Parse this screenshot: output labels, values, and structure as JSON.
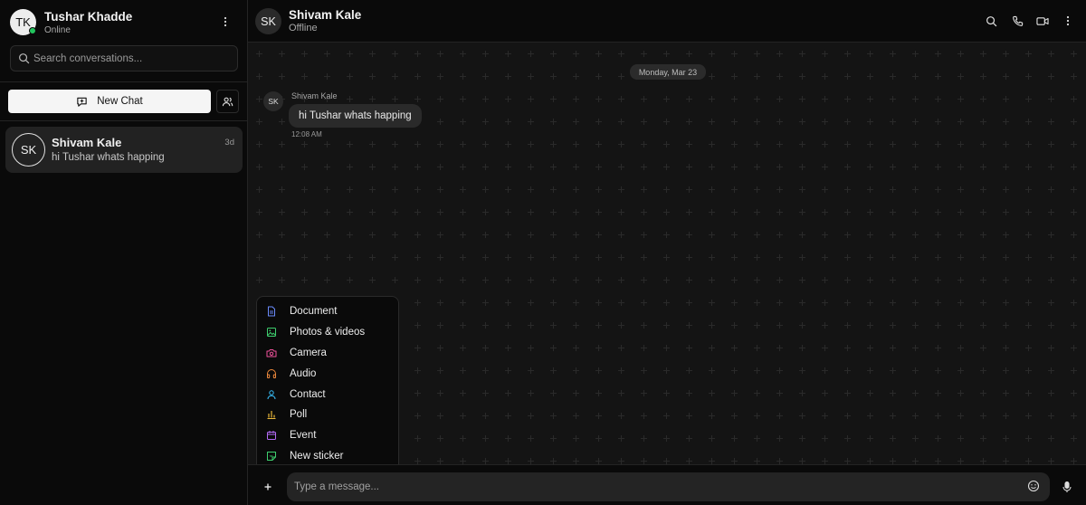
{
  "current_user": {
    "initials": "TK",
    "name": "Tushar Khadde",
    "status": "Online"
  },
  "search": {
    "placeholder": "Search conversations..."
  },
  "sidebar": {
    "new_chat_label": "New Chat"
  },
  "conversations": [
    {
      "initials": "SK",
      "name": "Shivam Kale",
      "time": "3d",
      "preview": "hi Tushar whats happing"
    }
  ],
  "chat": {
    "initials": "SK",
    "name": "Shivam Kale",
    "status": "Offline",
    "date_separator": "Monday, Mar 23",
    "messages": [
      {
        "sender_initials": "SK",
        "sender": "Shivam Kale",
        "text": "hi Tushar whats happing",
        "time": "12:08 AM"
      }
    ]
  },
  "attach_menu": [
    {
      "label": "Document",
      "icon": "document-icon",
      "color": "#6b8cff"
    },
    {
      "label": "Photos & videos",
      "icon": "image-icon",
      "color": "#3ecf6e"
    },
    {
      "label": "Camera",
      "icon": "camera-icon",
      "color": "#f0529c"
    },
    {
      "label": "Audio",
      "icon": "headphones-icon",
      "color": "#f08a3c"
    },
    {
      "label": "Contact",
      "icon": "user-icon",
      "color": "#38bdf8"
    },
    {
      "label": "Poll",
      "icon": "bar-chart-icon",
      "color": "#e9b73a"
    },
    {
      "label": "Event",
      "icon": "calendar-icon",
      "color": "#b36bf5"
    },
    {
      "label": "New sticker",
      "icon": "sticker-icon",
      "color": "#3ecf6e"
    }
  ],
  "composer": {
    "placeholder": "Type a message..."
  },
  "colors": {
    "online": "#22c55e",
    "background": "#141414",
    "panel": "#0a0a0a"
  }
}
